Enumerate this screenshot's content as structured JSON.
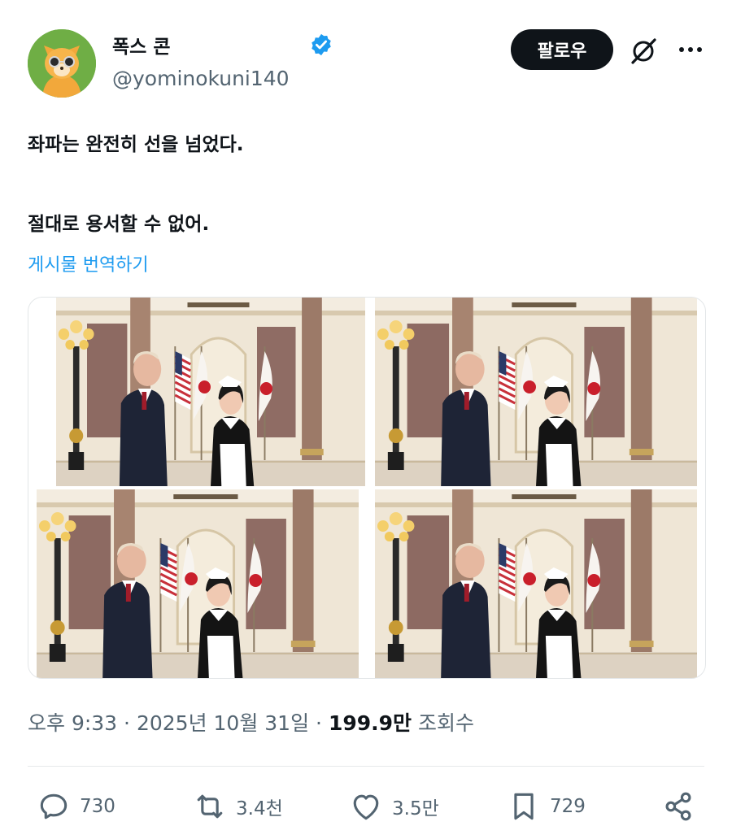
{
  "author": {
    "display_name": "폭스 콘",
    "handle": "@yominokuni140",
    "verified": true,
    "avatar_icon": "fox-character-avatar"
  },
  "header": {
    "follow_label": "팔로우",
    "grok_icon": "grok-icon",
    "more_icon": "more-icon"
  },
  "post": {
    "line1": "좌파는 완전히 선을 넘었다.",
    "line2": "절대로 용서할 수 없어.",
    "translate_label": "게시물 번역하기",
    "image_count": 4
  },
  "meta": {
    "time": "오후 9:33",
    "sep": "·",
    "date": "2025년 10월 31일",
    "views_value": "199.9만",
    "views_label": "조회수"
  },
  "actions": {
    "replies": "730",
    "reposts": "3.4천",
    "likes": "3.5만",
    "bookmarks": "729"
  },
  "colors": {
    "accent": "#1d9bf0",
    "text": "#0f1419",
    "muted": "#536471",
    "button_bg": "#0f1419"
  }
}
